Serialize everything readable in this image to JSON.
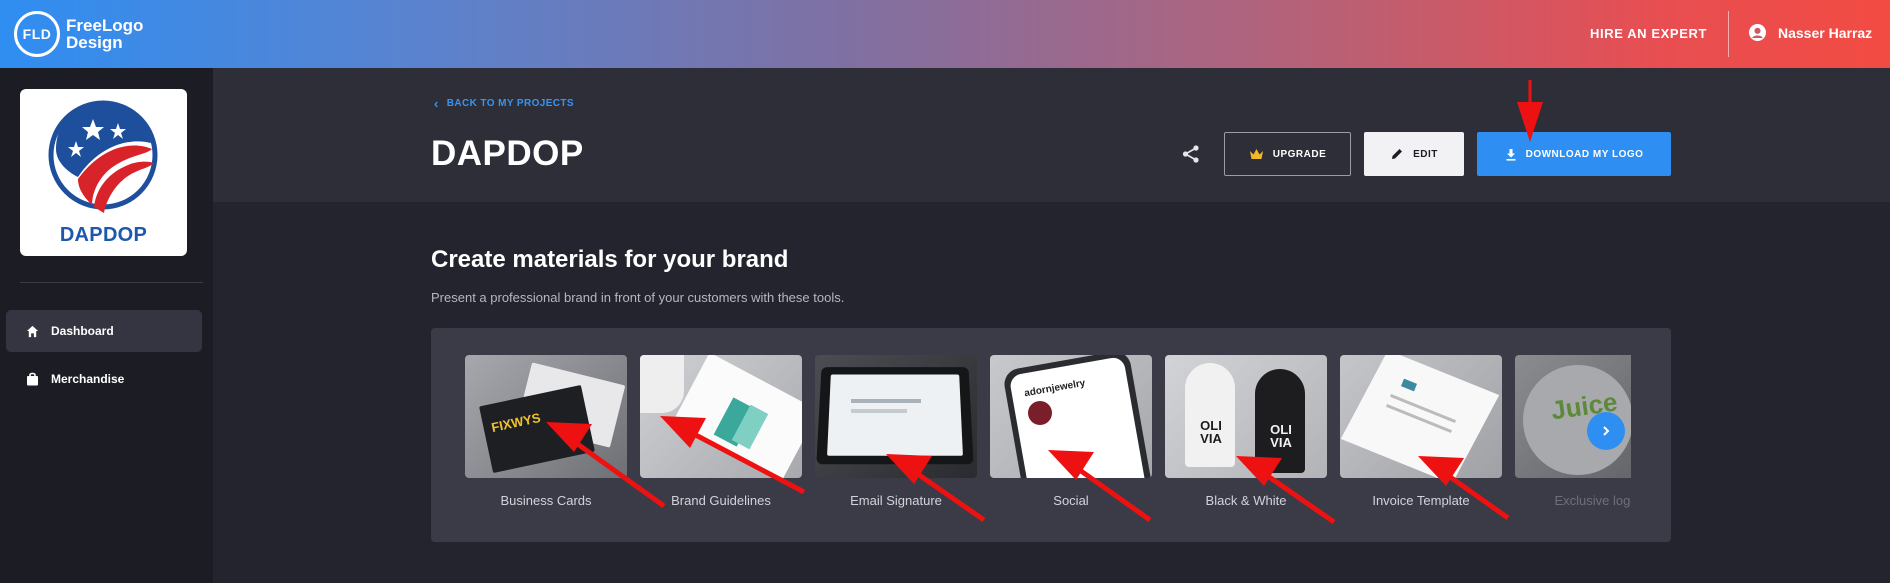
{
  "header": {
    "brand_initials": "FLD",
    "brand_line1": "FreeLogo",
    "brand_line2": "Design",
    "hire_label": "HIRE AN EXPERT",
    "user_name": "Nasser Harraz"
  },
  "sidebar": {
    "logo_name": "DAPDOP",
    "items": [
      {
        "label": "Dashboard",
        "icon": "home-icon",
        "active": true
      },
      {
        "label": "Merchandise",
        "icon": "shopping-bag-icon",
        "active": false
      }
    ]
  },
  "page": {
    "back_label": "BACK TO MY PROJECTS",
    "title": "DAPDOP",
    "upgrade_label": "UPGRADE",
    "edit_label": "EDIT",
    "download_label": "DOWNLOAD MY LOGO"
  },
  "materials": {
    "title": "Create materials for your brand",
    "subtitle": "Present a professional brand in front of your customers with these tools.",
    "cards": [
      {
        "label": "Business Cards",
        "thumb_text": "FIXWYS"
      },
      {
        "label": "Brand Guidelines"
      },
      {
        "label": "Email Signature"
      },
      {
        "label": "Social",
        "thumb_text": "adornjewelry"
      },
      {
        "label": "Black & White",
        "thumb_text": "OLI VIA"
      },
      {
        "label": "Invoice Template"
      },
      {
        "label": "Exclusive logo",
        "thumb_text": "Juice"
      }
    ]
  },
  "colors": {
    "accent": "#2e8ef2",
    "annotation": "#ee1111"
  }
}
